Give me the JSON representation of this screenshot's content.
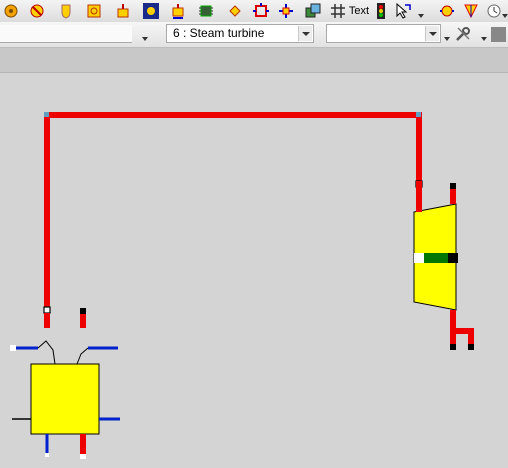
{
  "toolbar": {
    "text_tool_label": "Text"
  },
  "component_selector": {
    "value": "6 : Steam turbine"
  },
  "secondary_selector": {
    "value": ""
  },
  "colors": {
    "steam_line": "#ee0000",
    "component_fill": "#ffff00",
    "water_line": "#0022cc",
    "canvas_background": "#d4d4d4"
  }
}
